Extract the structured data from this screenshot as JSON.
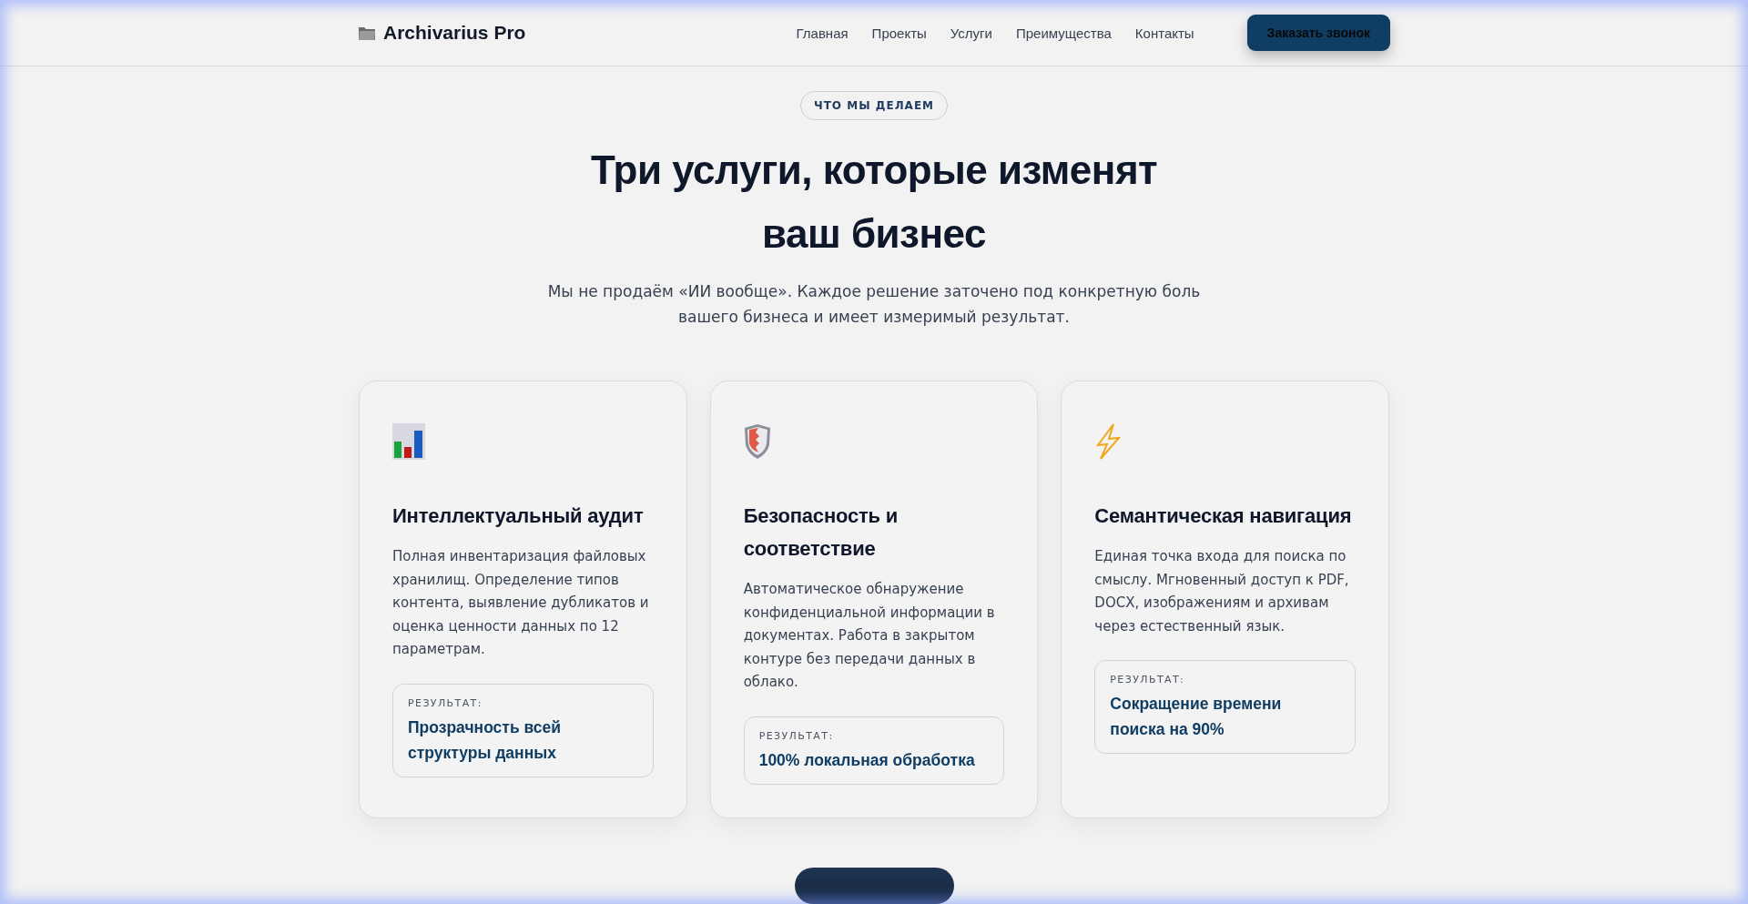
{
  "header": {
    "logo": "Archivarius Pro",
    "nav": [
      {
        "label": "Главная"
      },
      {
        "label": "Проекты"
      },
      {
        "label": "Услуги"
      },
      {
        "label": "Преимущества"
      },
      {
        "label": "Контакты"
      }
    ],
    "cta": "Заказать звонок"
  },
  "section": {
    "badge": "ЧТО МЫ ДЕЛАЕМ",
    "title_lines": [
      "Три услуги, которые изменят",
      "ваш бизнес"
    ],
    "subtitle_lines": [
      "Мы не продаём «ИИ вообще». Каждое решение заточено под конкретную боль",
      "вашего бизнеса и имеет измеримый результат."
    ]
  },
  "cards": [
    {
      "kind": "chart",
      "title_lines": [
        "Интеллектуальный аудит"
      ],
      "description": "Полная инвентаризация файловых хранилищ. Определение типов контента, выявление дубликатов и оценка ценности данных по 12 параметрам.",
      "result_label": "РЕЗУЛЬТАТ:",
      "result_lines": [
        "Прозрачность всей",
        "структуры данных"
      ]
    },
    {
      "kind": "shield",
      "title_lines": [
        "Безопасность и",
        "соответствие"
      ],
      "description": "Автоматическое обнаружение конфиденциальной информации в документах. Работа в закрытом контуре без передачи данных в облако.",
      "result_label": "РЕЗУЛЬТАТ:",
      "result_lines": [
        "100% локальная обработка"
      ]
    },
    {
      "kind": "bolt",
      "title_lines": [
        "Семантическая навигация"
      ],
      "description": "Единая точка входа для поиска по смыслу. Мгновенный доступ к PDF, DOCX, изображениям и архивам через естественный язык.",
      "result_label": "РЕЗУЛЬТАТ:",
      "result_lines": [
        "Сокращение времени",
        "поиска на 90%"
      ]
    }
  ]
}
